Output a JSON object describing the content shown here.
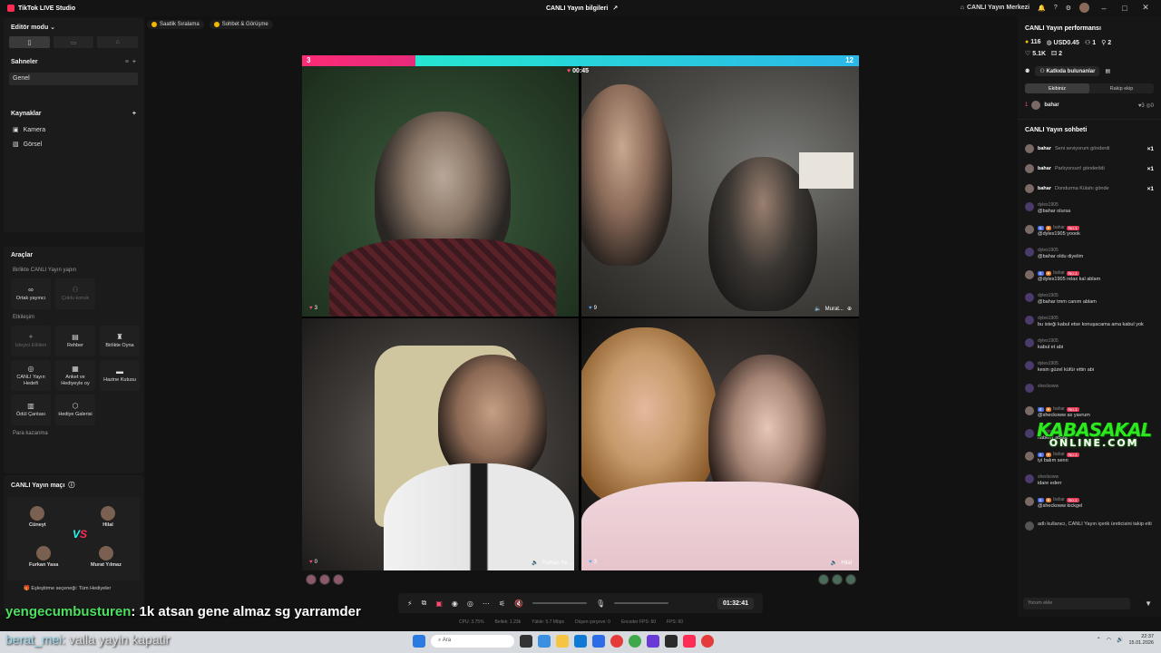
{
  "app": {
    "title": "TikTok LIVE Studio"
  },
  "header": {
    "center_title": "CANLI Yayın bilgileri",
    "live_center": "CANLI Yayın Merkezi",
    "notif_count": "4"
  },
  "left": {
    "editor_mode": "Editör modu",
    "scenes_title": "Sahneler",
    "scene_item": "Genel",
    "sources_title": "Kaynaklar",
    "sources": [
      "Kamera",
      "Görsel"
    ],
    "tools_title": "Araçlar",
    "together_title": "Birlikte CANLI Yayın yapın",
    "cohost": "Ortak yayıncı",
    "multi_guest": "Çoklu konuk",
    "engagement_title": "Etkileşim",
    "engage_tools": [
      "İzleyici Etkileri",
      "Rehber",
      "Birlikte Oyna",
      "CANLI Yayın Hedefi",
      "Anket ve Hediyeyle oy",
      "Hazine Kutusu",
      "Ödül Çantası",
      "Hediye Galerisi"
    ],
    "earn_title": "Para kazanma",
    "match_title": "CANLI Yayın maçı",
    "players": [
      "Cüneyt",
      "Hilal",
      "Furkan Yasa",
      "Murat Yılmaz"
    ],
    "match_footer": "Eşleştirme seçeneği: Tüm Hediyeler"
  },
  "chips": [
    "Saatlik Sıralama",
    "Sohbet & Görüşme"
  ],
  "stage": {
    "score_left": "3",
    "score_right": "12",
    "timer": "00:45",
    "tiles": [
      {
        "count": "3",
        "name": ""
      },
      {
        "count": "9",
        "name": "Murat..."
      },
      {
        "count": "0",
        "name": "Furkan Ya..."
      },
      {
        "count": "3",
        "name": "Hilal"
      }
    ]
  },
  "controls": {
    "clock": "01:32:41"
  },
  "stats": [
    "CPU: 3.75%",
    "Bellek: 1.23k",
    "Yükle: 5.7 Mbps",
    "Düşen çerçeve: 0",
    "Encoder FPS: 60",
    "FPS: 60"
  ],
  "right": {
    "perf_title": "CANLI Yayın performansı",
    "perf": {
      "coins": "116",
      "usd": "USD0.45",
      "viewers": "1",
      "shares": "2",
      "likes": "5.1K",
      "gifts": "2"
    },
    "contributors": "Katkıda bulunanlar",
    "tabs": [
      "Ekibiniz",
      "Rakip ekip"
    ],
    "rank": {
      "pos": "1",
      "name": "bahar",
      "hearts": "3",
      "other": "0"
    },
    "chat_title": "CANLI Yayın sohbeti",
    "gifts": [
      {
        "user": "bahar",
        "text": "Seni seviyorum gönderdi",
        "count": "×1"
      },
      {
        "user": "bahar",
        "text": "Parlıyorsun! gönderildi",
        "count": "×1"
      },
      {
        "user": "bahar",
        "text": "Dondurma Külahı gönde",
        "count": "×1"
      }
    ],
    "messages": [
      {
        "user": "dyles1905",
        "badges": false,
        "text": "@bahar olursa"
      },
      {
        "user": "bahar",
        "badges": true,
        "text": "@dyles1905 yoook"
      },
      {
        "user": "dyles1905",
        "badges": false,
        "text": "@bahar oldu diyelim"
      },
      {
        "user": "bahar",
        "badges": true,
        "text": "@dyles1905 relax kal ablam"
      },
      {
        "user": "dyles1905",
        "badges": false,
        "text": "@bahar tmm canım ablam"
      },
      {
        "user": "dyles1905",
        "badges": false,
        "text": "bu isteği kabul etse konuşacama ama kabul yok"
      },
      {
        "user": "dyles1905",
        "badges": false,
        "text": "kabul et abi"
      },
      {
        "user": "dyles1905",
        "badges": false,
        "text": "kesin güzel küfür ettin abi"
      },
      {
        "user": "sheckoww",
        "badges": false,
        "text": ""
      },
      {
        "user": "bahar",
        "badges": true,
        "text": "@sheckoww as yavrum"
      },
      {
        "user": "sheckoww",
        "badges": false,
        "text": "naberrr ablaa"
      },
      {
        "user": "bahar",
        "badges": true,
        "text": "iyi balım senn"
      },
      {
        "user": "sheckoww",
        "badges": false,
        "text": "idare ederr"
      },
      {
        "user": "bahar",
        "badges": true,
        "text": "@sheckoww kickgel"
      }
    ],
    "system_msg": "adlı kullanıcı, CANLI Yayın içerik üreticisini takip etti",
    "badge_lvl": "6",
    "badge_no1": "No.1",
    "chat_placeholder": "Yorum ekle"
  },
  "watermark": {
    "top": "KABASAKAL",
    "bottom": "ONLINE.COM"
  },
  "overlay": [
    {
      "user": "yengecumbusturen",
      "text": ": 1k atsan gene almaz sg yarramder"
    },
    {
      "user": "berat_mei",
      "text": ": valla yayin kapatir"
    }
  ],
  "taskbar": {
    "search": "Ara",
    "time": "22:37",
    "date": "15.01.2026"
  }
}
